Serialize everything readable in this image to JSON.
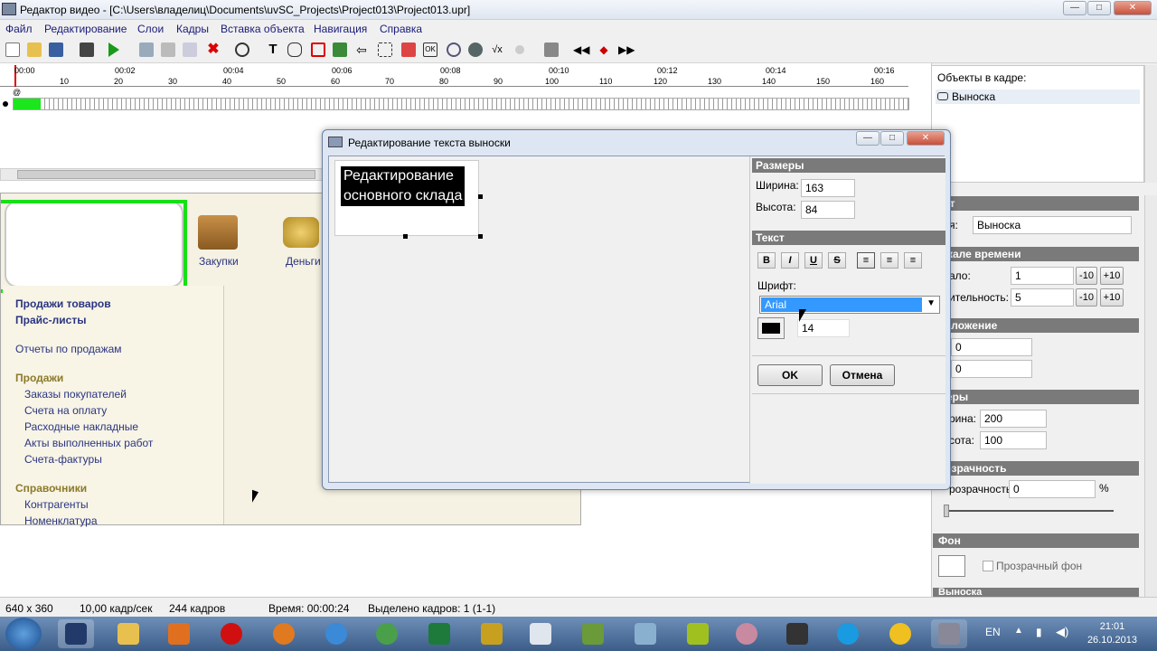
{
  "app": {
    "title": "Редактор видео - [C:\\Users\\владелиц\\Documents\\uvSC_Projects\\Project013\\Project013.upr]"
  },
  "menu": [
    "Файл",
    "Редактирование",
    "Слои",
    "Кадры",
    "Вставка объекта",
    "Навигация",
    "Справка"
  ],
  "timeline": {
    "time_ticks": [
      "00:00",
      "00:02",
      "00:04",
      "00:06",
      "00:08",
      "00:10",
      "00:12",
      "00:14",
      "00:16"
    ],
    "frame_ticks": [
      "10",
      "20",
      "30",
      "40",
      "50",
      "60",
      "70",
      "80",
      "90",
      "100",
      "110",
      "120",
      "130",
      "140",
      "150",
      "160"
    ],
    "marker": "@"
  },
  "canvas": {
    "icons": [
      {
        "label": "Закупки",
        "icon": "boxes-icon"
      },
      {
        "label": "Деньги",
        "icon": "coins-icon"
      }
    ],
    "nav": {
      "bold_items": [
        "Продажи товаров",
        "Прайс-листы"
      ],
      "report": "Отчеты по продажам",
      "sales_header": "Продажи",
      "sales_items": [
        "Заказы покупателей",
        "Счета на оплату",
        "Расходные накладные",
        "Акты выполненных работ",
        "Счета-фактуры"
      ],
      "ref_header": "Справочники",
      "ref_items": [
        "Контрагенты",
        "Номенклатура"
      ]
    }
  },
  "objects_panel": {
    "header": "Объекты в кадре:",
    "item": "Выноска"
  },
  "props": {
    "object_header": "ект",
    "name_label": "я:",
    "name_value": "Выноска",
    "timescale_header": "шкале времени",
    "start_label": "ало:",
    "start_value": "1",
    "duration_label": "ительность:",
    "duration_value": "5",
    "minus10": "-10",
    "plus10": "+10",
    "position_header": "положение",
    "pos_x": "0",
    "pos_y": "0",
    "size_header": "меры",
    "width_label": "рина:",
    "width_value": "200",
    "height_label": "сота:",
    "height_value": "100",
    "transp_header": "розрачность",
    "transp_label": "розрачность:",
    "transp_value": "0",
    "transp_unit": "%",
    "bg_header": "Фон",
    "bg_checkbox": "Прозрачный фон",
    "callout_header": "Выноска"
  },
  "dialog": {
    "title": "Редактирование текста выноски",
    "text_lines": [
      "Редактирование",
      "основного склада"
    ],
    "sizes_header": "Размеры",
    "width_label": "Ширина:",
    "width_value": "163",
    "height_label": "Высота:",
    "height_value": "84",
    "text_header": "Текст",
    "format_buttons": [
      "B",
      "I",
      "U",
      "S"
    ],
    "font_label": "Шрифт:",
    "font_value": "Arial",
    "font_size": "14",
    "ok": "OK",
    "cancel": "Отмена"
  },
  "status": {
    "resolution": "640 x 360",
    "fps": "10,00 кадр/сек",
    "frames": "244 кадров",
    "time": "Время: 00:00:24",
    "selected": "Выделено кадров: 1 (1-1)"
  },
  "taskbar": {
    "lang": "EN",
    "time": "21:01",
    "date": "26.10.2013"
  },
  "colors": {
    "green_selection": "#16e016",
    "header_gray": "#7a7a7a",
    "select_blue": "#3399ff"
  }
}
